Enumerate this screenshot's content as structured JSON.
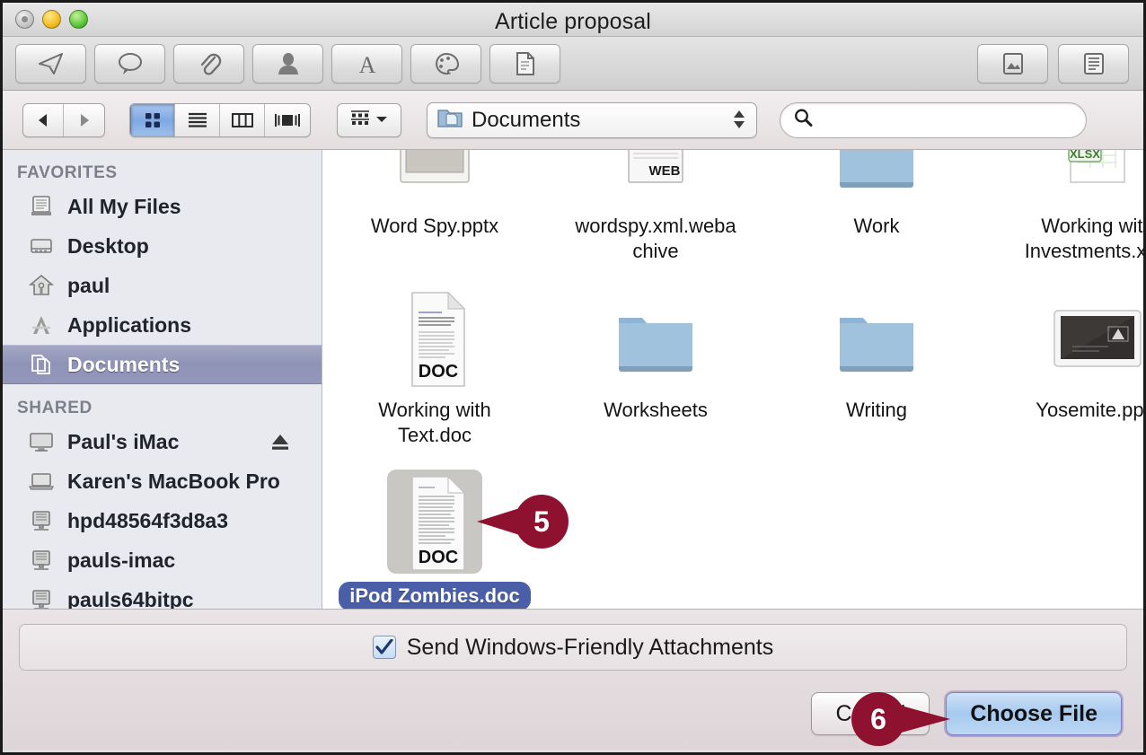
{
  "window": {
    "title": "Article proposal",
    "traffic_lights": [
      "close",
      "minimize",
      "zoom"
    ]
  },
  "mail_toolbar": {
    "left_buttons": [
      {
        "name": "send-icon",
        "label": "Send"
      },
      {
        "name": "chat-bubble-icon",
        "label": "Chat"
      },
      {
        "name": "paperclip-icon",
        "label": "Attach"
      },
      {
        "name": "person-icon",
        "label": "Address"
      },
      {
        "name": "font-icon",
        "label": "Fonts"
      },
      {
        "name": "palette-icon",
        "label": "Colors"
      },
      {
        "name": "stationery-icon",
        "label": "Stationery"
      }
    ],
    "right_buttons": [
      {
        "name": "photo-browser-icon",
        "label": "Photo Browser"
      },
      {
        "name": "stationery-pane-icon",
        "label": "Show Stationery"
      }
    ]
  },
  "navbar": {
    "back_label": "Back",
    "forward_label": "Forward",
    "view_modes": [
      {
        "name": "icon-view",
        "label": "Icon View",
        "selected": true
      },
      {
        "name": "list-view",
        "label": "List View",
        "selected": false
      },
      {
        "name": "column-view",
        "label": "Column View",
        "selected": false
      },
      {
        "name": "coverflow-view",
        "label": "Cover Flow View",
        "selected": false
      }
    ],
    "arrange_label": "Arrange",
    "path": {
      "icon": "documents-folder-icon",
      "label": "Documents"
    },
    "search": {
      "icon": "search-icon",
      "value": "",
      "placeholder": ""
    }
  },
  "sidebar": {
    "sections": [
      {
        "header": "FAVORITES",
        "items": [
          {
            "label": "All My Files",
            "icon": "all-my-files-icon",
            "selected": false
          },
          {
            "label": "Desktop",
            "icon": "desktop-icon",
            "selected": false
          },
          {
            "label": "paul",
            "icon": "home-icon",
            "selected": false
          },
          {
            "label": "Applications",
            "icon": "applications-icon",
            "selected": false
          },
          {
            "label": "Documents",
            "icon": "documents-icon",
            "selected": true
          }
        ]
      },
      {
        "header": "SHARED",
        "items": [
          {
            "label": "Paul's iMac",
            "icon": "imac-icon",
            "selected": false,
            "eject": true
          },
          {
            "label": "Karen's MacBook Pro",
            "icon": "macbook-icon",
            "selected": false
          },
          {
            "label": "hpd48564f3d8a3",
            "icon": "pc-icon",
            "selected": false
          },
          {
            "label": "pauls-imac",
            "icon": "pc-icon",
            "selected": false
          },
          {
            "label": "pauls64bitpc",
            "icon": "pc-icon",
            "selected": false
          }
        ]
      }
    ]
  },
  "files": [
    {
      "name": "Word Spy.pptx",
      "icon": "pptx-icon",
      "selected": false
    },
    {
      "name": "wordspy.xml.weba\nchive",
      "icon": "webarchive-icon",
      "selected": false
    },
    {
      "name": "Work",
      "icon": "folder-icon",
      "selected": false
    },
    {
      "name": "Working with\nInvestments.xlsx",
      "icon": "xlsx-icon",
      "selected": false
    },
    {
      "name": "Working with\nText.doc",
      "icon": "doc-icon",
      "selected": false
    },
    {
      "name": "Worksheets",
      "icon": "folder-icon",
      "selected": false
    },
    {
      "name": "Writing",
      "icon": "folder-icon",
      "selected": false
    },
    {
      "name": "Yosemite.pptx",
      "icon": "pptx-dark-icon",
      "selected": false
    },
    {
      "name": "iPod Zombies.doc",
      "icon": "doc-icon",
      "selected": true
    }
  ],
  "footer": {
    "checkbox": {
      "label": "Send Windows-Friendly Attachments",
      "checked": true
    },
    "cancel_label": "Cancel",
    "choose_label": "Choose File"
  },
  "callouts": [
    {
      "id": "5",
      "number": "5"
    },
    {
      "id": "6",
      "number": "6"
    }
  ],
  "colors": {
    "callout": "#8e1230",
    "selection_blue": "#4a5fa8",
    "sidebar_selected": "#8f93b6",
    "folder_blue": "#8bb0d4",
    "default_button": "#a7c9ef"
  }
}
